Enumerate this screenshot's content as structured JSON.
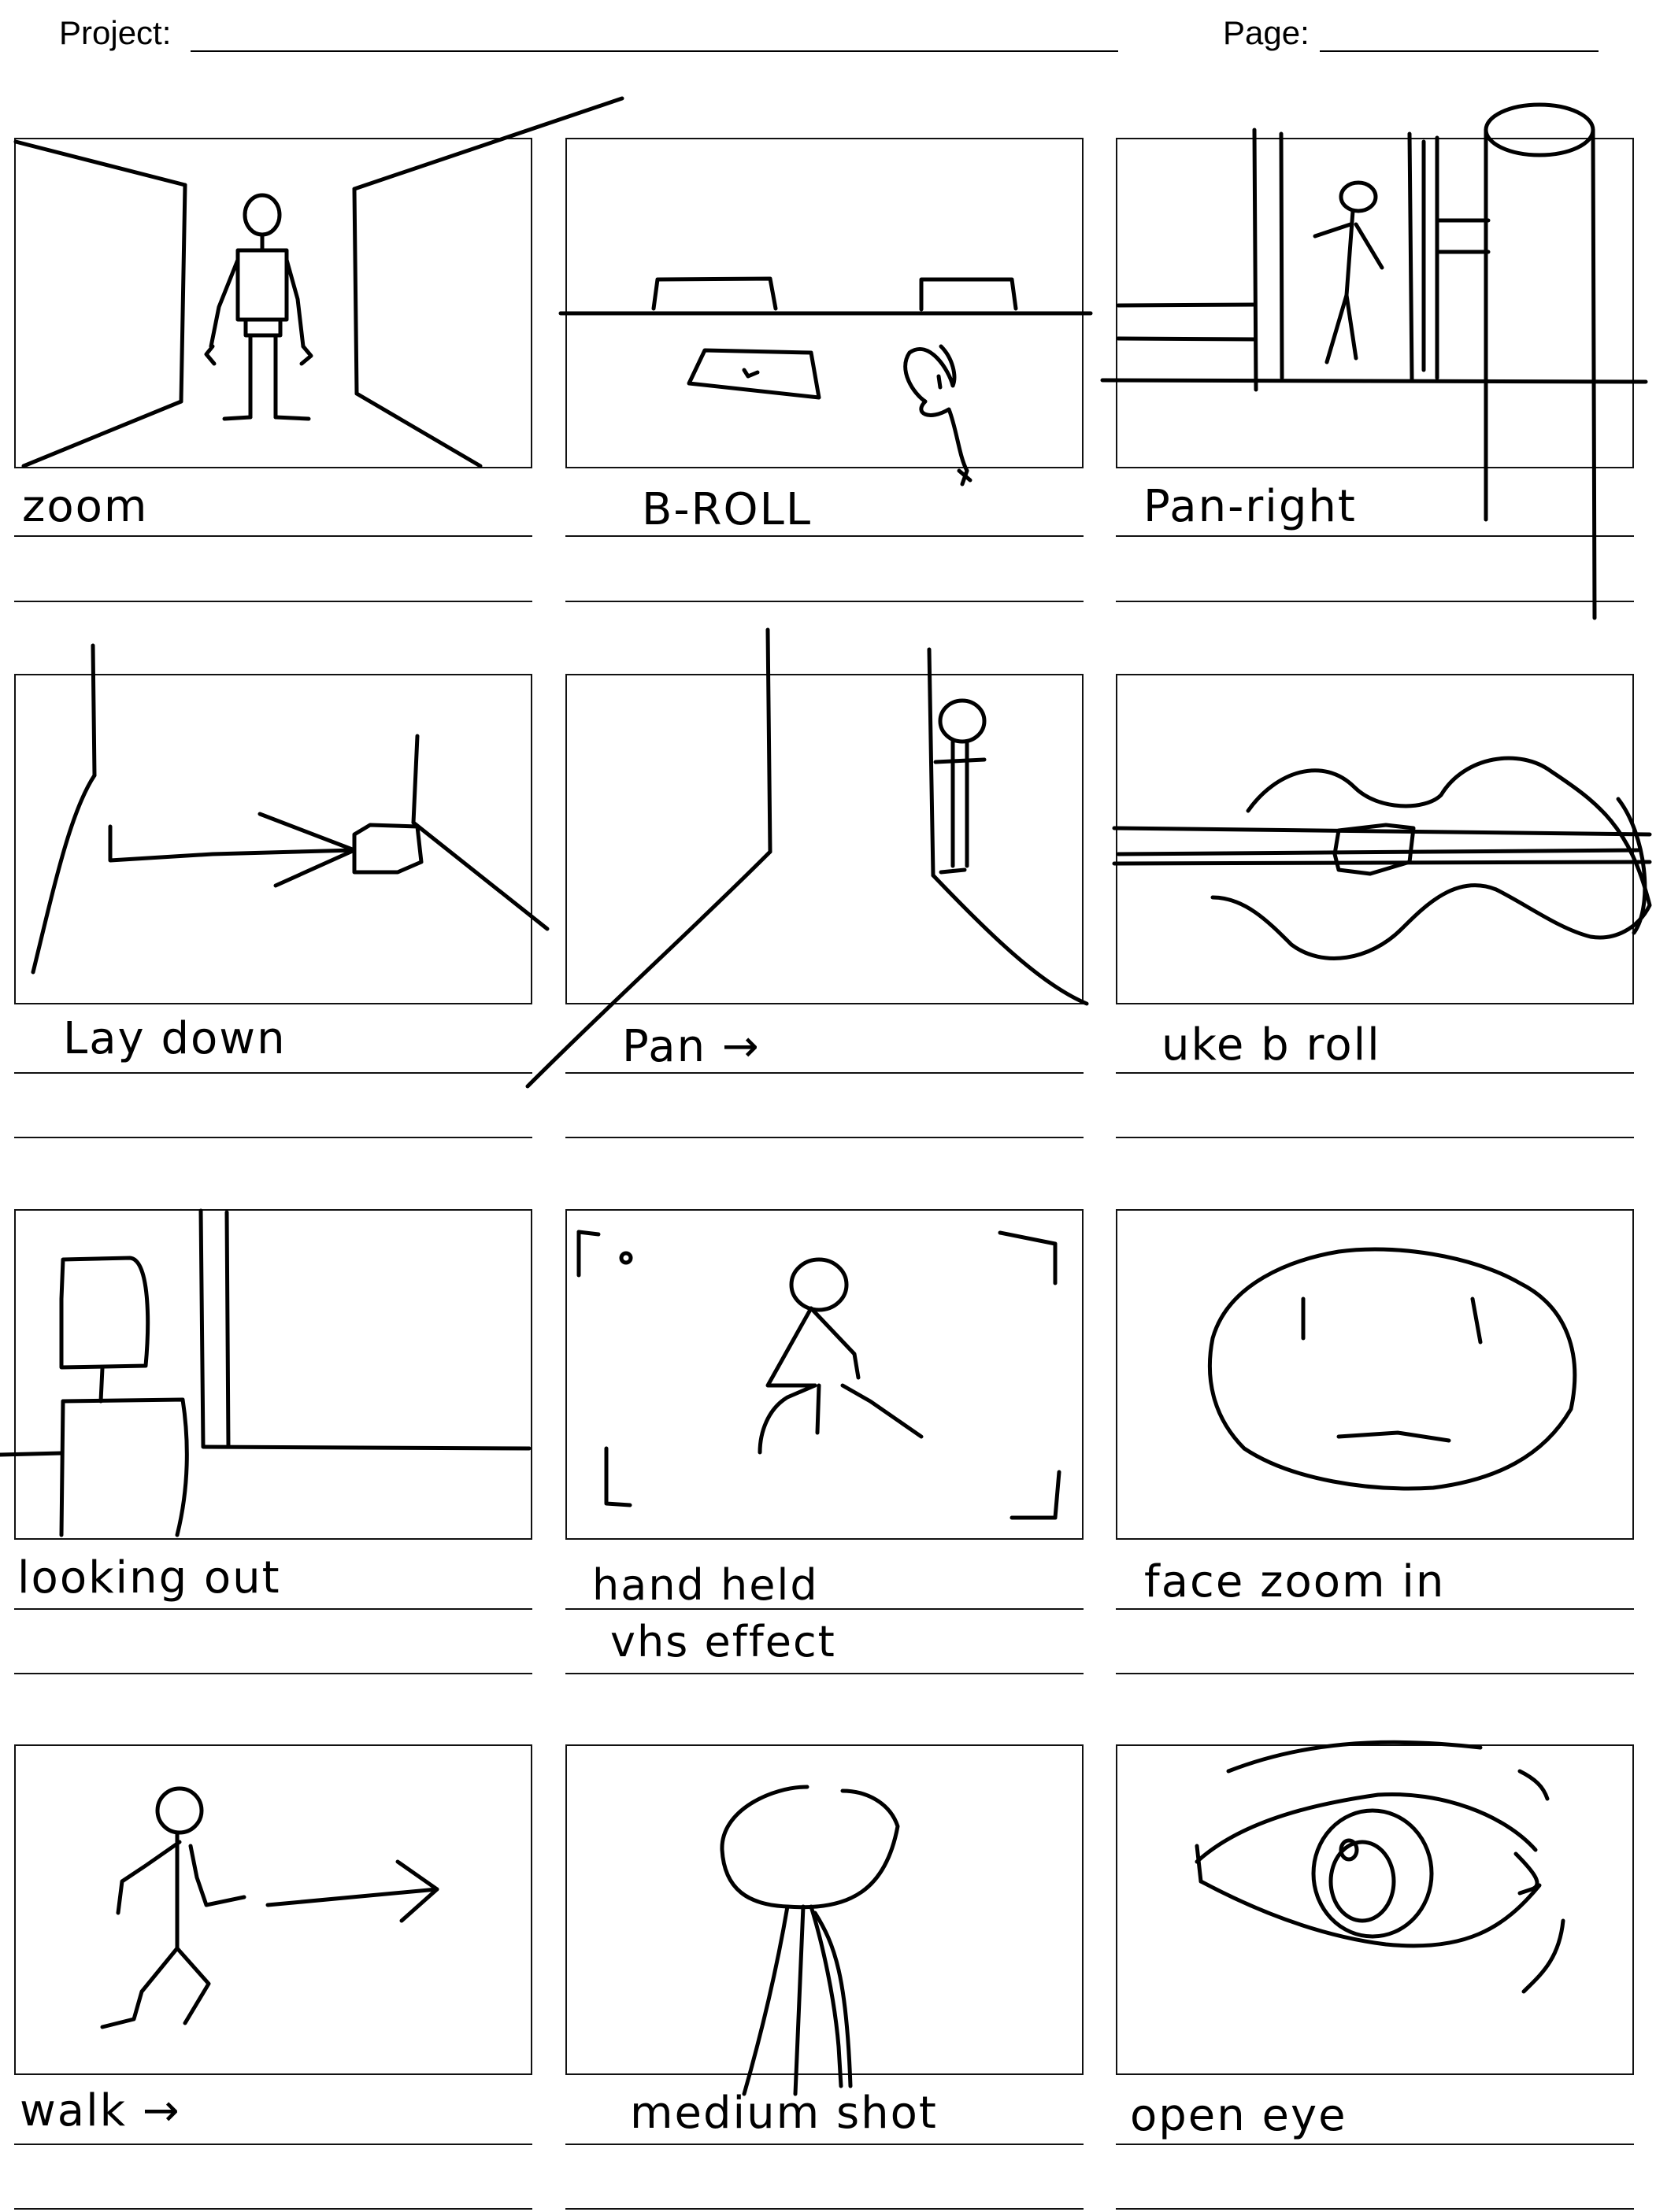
{
  "header": {
    "project_label": "Project:",
    "page_label": "Page:"
  },
  "panels": [
    {
      "caption": "zoom"
    },
    {
      "caption": "B-ROLL"
    },
    {
      "caption": "Pan-right"
    },
    {
      "caption": "Lay down"
    },
    {
      "caption": "Pan →"
    },
    {
      "caption": "uke b roll"
    },
    {
      "caption": "looking out"
    },
    {
      "caption": "hand held",
      "caption2": "vhs effect"
    },
    {
      "caption": "face zoom in"
    },
    {
      "caption": "walk →"
    },
    {
      "caption": "medium shot"
    },
    {
      "caption": "open eye"
    }
  ]
}
